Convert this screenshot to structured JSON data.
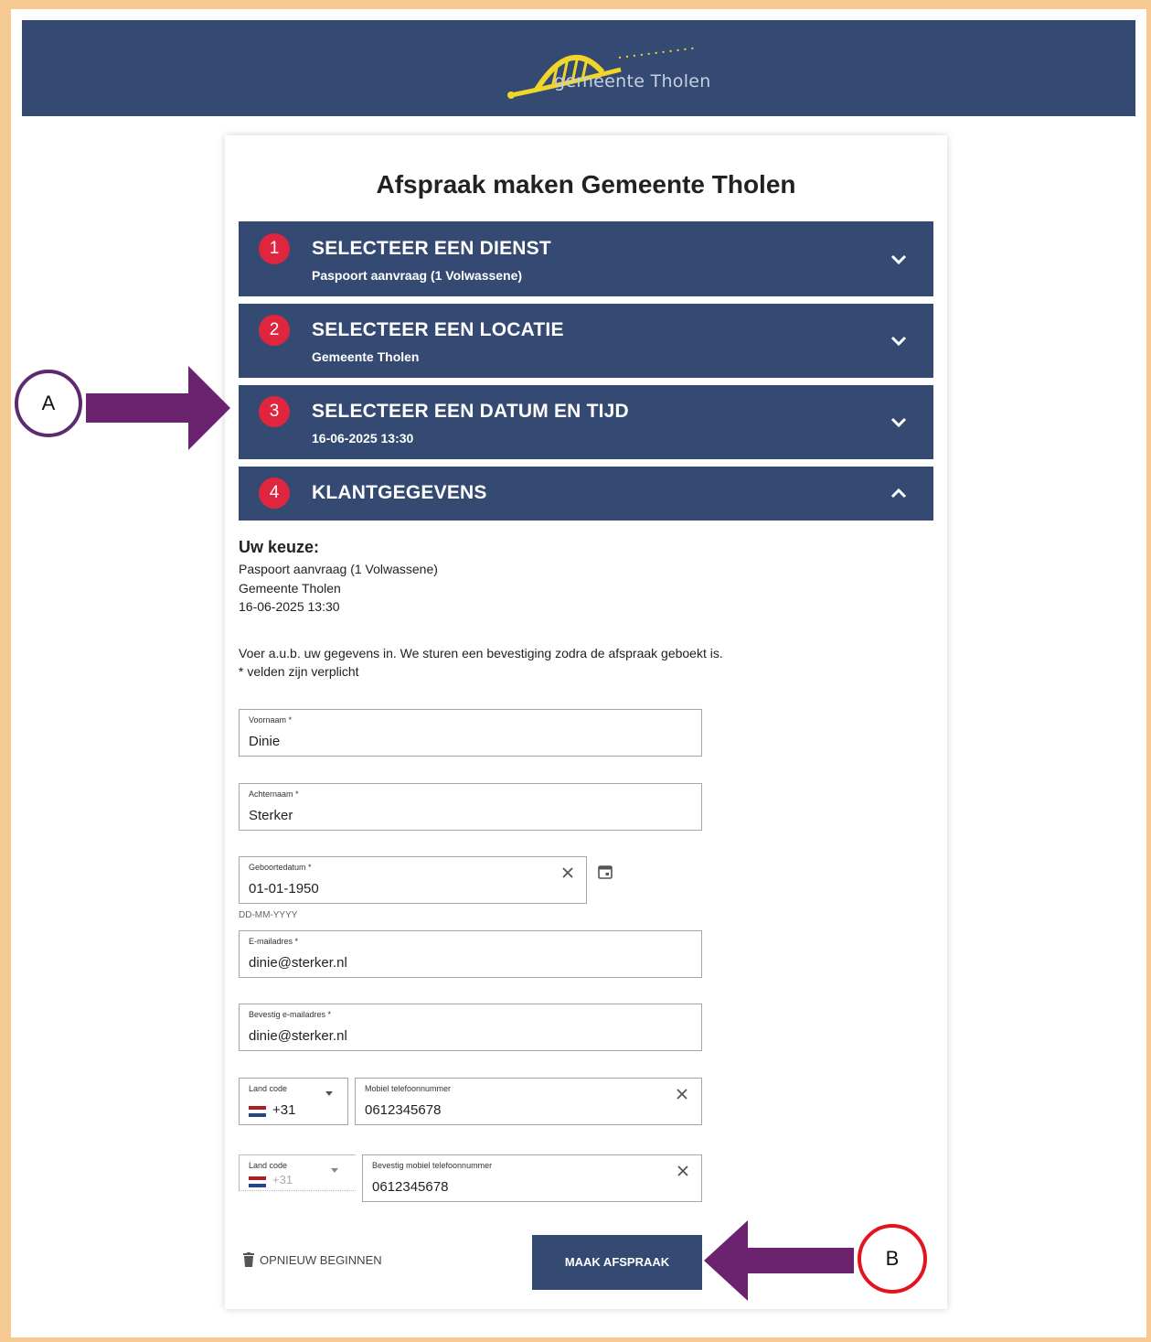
{
  "header": {
    "logo_text": "gemeente Tholen",
    "brand_color": "#344a73"
  },
  "page": {
    "title": "Afspraak maken Gemeente Tholen"
  },
  "steps": [
    {
      "number": "1",
      "title": "SELECTEER EEN DIENST",
      "subtitle": "Paspoort aanvraag (1 Volwassene)",
      "expanded": false
    },
    {
      "number": "2",
      "title": "SELECTEER EEN LOCATIE",
      "subtitle": "Gemeente Tholen",
      "expanded": false
    },
    {
      "number": "3",
      "title": "SELECTEER EEN DATUM EN TIJD",
      "subtitle": "16-06-2025 13:30",
      "expanded": false
    },
    {
      "number": "4",
      "title": "KLANTGEGEVENS",
      "subtitle": "",
      "expanded": true
    }
  ],
  "summary": {
    "heading": "Uw keuze:",
    "service": "Paspoort aanvraag (1 Volwassene)",
    "location": "Gemeente Tholen",
    "datetime": "16-06-2025 13:30",
    "instruction": "Voer a.u.b. uw gegevens in. We sturen een bevestiging zodra de afspraak geboekt is.",
    "required_note": "* velden zijn verplicht"
  },
  "form": {
    "first_name": {
      "label": "Voornaam *",
      "value": "Dinie"
    },
    "last_name": {
      "label": "Achternaam *",
      "value": "Sterker"
    },
    "birthdate": {
      "label": "Geboortedatum *",
      "value": "01-01-1950",
      "hint": "DD-MM-YYYY"
    },
    "email": {
      "label": "E-mailadres *",
      "value": "dinie@sterker.nl"
    },
    "email_confirm": {
      "label": "Bevestig e-mailadres *",
      "value": "dinie@sterker.nl"
    },
    "country_code": {
      "label": "Land code",
      "value": "+31"
    },
    "phone": {
      "label": "Mobiel telefoonnummer",
      "value": "0612345678"
    },
    "country_code_confirm": {
      "label": "Land code",
      "value": "+31"
    },
    "phone_confirm": {
      "label": "Bevestig mobiel telefoonnummer",
      "value": "0612345678"
    }
  },
  "actions": {
    "restart_label": "OPNIEUW BEGINNEN",
    "submit_label": "MAAK AFSPRAAK"
  },
  "annotations": {
    "a_label": "A",
    "b_label": "B",
    "arrow_color": "#6b2370"
  }
}
